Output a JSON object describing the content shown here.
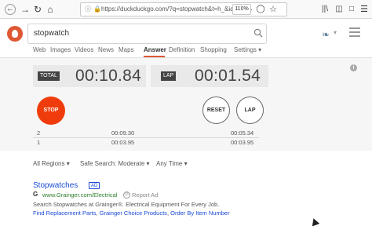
{
  "browser": {
    "url": "https://duckduckgo.com/?q=stopwatch&t=h_&ia=",
    "url_more": "···",
    "zoom": "110%",
    "back_icon": "back-arrow-icon",
    "forward_icon": "forward-arrow-icon",
    "reload_icon": "reload-icon",
    "home_icon": "home-icon"
  },
  "search": {
    "query": "stopwatch"
  },
  "tabs": [
    {
      "label": "Web"
    },
    {
      "label": "Images"
    },
    {
      "label": "Videos"
    },
    {
      "label": "News"
    },
    {
      "label": "Maps"
    },
    {
      "label": "Answer"
    },
    {
      "label": "Definition"
    },
    {
      "label": "Shopping"
    },
    {
      "label": "Settings ▾"
    }
  ],
  "stopwatch": {
    "total_label": "TOTAL",
    "total_value": "00:10.84",
    "lap_label": "LAP",
    "lap_value": "00:01.54",
    "stop_label": "STOP",
    "reset_label": "RESET",
    "lap_button_label": "LAP",
    "info": "i",
    "laps": [
      {
        "n": "2",
        "time": "00:09.30",
        "total": "00:05.34"
      },
      {
        "n": "1",
        "time": "00:03.95",
        "total": "00:03.95"
      }
    ]
  },
  "filters": {
    "region": "All Regions ▾",
    "safe_search": "Safe Search: Moderate ▾",
    "time": "Any Time ▾"
  },
  "ad": {
    "title": "Stopwatches",
    "badge": "AD",
    "url": "www.Grainger.com/Electrical",
    "report": "Report Ad",
    "description": "Search Stopwatches at Grainger®. Electrical Equipment For Every Job.",
    "links": [
      "Find Replacement Parts",
      "Grainger Choice Products",
      "Order By Item Number"
    ],
    "separator": ","
  },
  "colors": {
    "accent": "#de5833",
    "stop": "#f03c0c",
    "link": "#1a4bd8"
  }
}
